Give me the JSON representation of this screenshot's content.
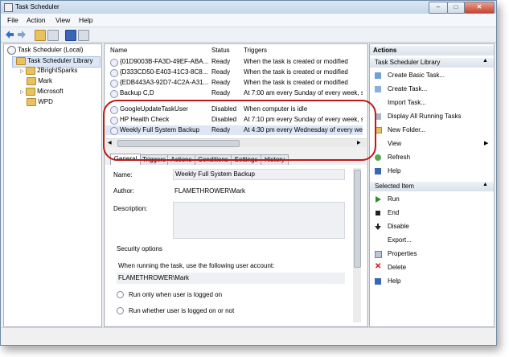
{
  "window": {
    "title": "Task Scheduler",
    "btn_min": "–",
    "btn_max": "□",
    "btn_close": "✕"
  },
  "menu": [
    "File",
    "Action",
    "View",
    "Help"
  ],
  "tree": {
    "root": "Task Scheduler (Local)",
    "library": "Task Scheduler Library",
    "folders": [
      "2BrightSparks",
      "Mark",
      "Microsoft",
      "WPD"
    ]
  },
  "tasks": {
    "headers": {
      "name": "Name",
      "status": "Status",
      "triggers": "Triggers"
    },
    "rows": [
      {
        "name": "{01D9003B-FA3D-49EF-ABA...",
        "status": "Ready",
        "trigger": "When the task is created or modified"
      },
      {
        "name": "{D333CD50-E403-41C3-8C8...",
        "status": "Ready",
        "trigger": "When the task is created or modified"
      },
      {
        "name": "{EDB443A3-92D7-4C2A-A31...",
        "status": "Ready",
        "trigger": "When the task is created or modified"
      },
      {
        "name": "Backup C,D",
        "status": "Ready",
        "trigger": "At 7:00 am every Sunday of every week, s"
      },
      {
        "name": "GoogleUpdateTaskUser",
        "status": "Disabled",
        "trigger": "When computer is idle"
      },
      {
        "name": "HP Health Check",
        "status": "Disabled",
        "trigger": "At 7:10 pm every Sunday of every week, s"
      },
      {
        "name": "Weekly Full System Backup",
        "status": "Ready",
        "trigger": "At 4:30 pm every Wednesday of every we"
      }
    ]
  },
  "tabs": [
    "General",
    "Triggers",
    "Actions",
    "Conditions",
    "Settings",
    "History"
  ],
  "general": {
    "name_label": "Name:",
    "name_value": "Weekly Full System Backup",
    "author_label": "Author:",
    "author_value": "FLAMETHROWER\\Mark",
    "description_label": "Description:",
    "security_title": "Security options",
    "account_prompt": "When running the task, use the following user account:",
    "account_value": "FLAMETHROWER\\Mark",
    "radio1": "Run only when user is logged on",
    "radio2": "Run whether user is logged on or not"
  },
  "actions": {
    "header": "Actions",
    "library_header": "Task Scheduler Library",
    "library_items": [
      "Create Basic Task...",
      "Create Task...",
      "Import Task...",
      "Display All Running Tasks",
      "New Folder...",
      "View",
      "Refresh",
      "Help"
    ],
    "selected_header": "Selected Item",
    "selected_items": [
      "Run",
      "End",
      "Disable",
      "Export...",
      "Properties",
      "Delete",
      "Help"
    ]
  },
  "colors": {
    "highlight_ring": "#c21818",
    "selected_row": "#dce6f4"
  }
}
